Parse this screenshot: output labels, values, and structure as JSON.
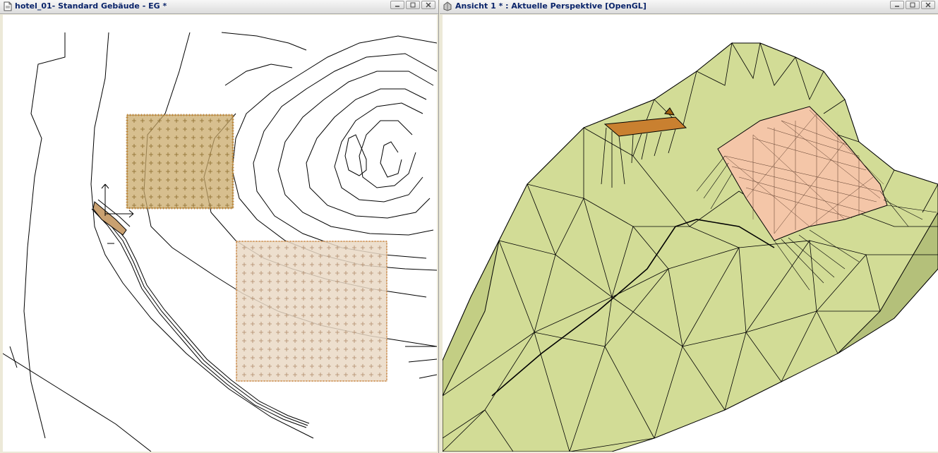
{
  "left_window": {
    "title": "hotel_01- Standard Gebäude - EG *",
    "icon": "document-icon",
    "buttons": [
      "minimize-icon",
      "maximize-icon",
      "close-icon"
    ]
  },
  "right_window": {
    "title": "Ansicht 1 *  : Aktuelle Perspektive [OpenGL]",
    "icon": "view-icon",
    "buttons": [
      "minimize-icon",
      "maximize-icon",
      "close-icon"
    ]
  },
  "colors": {
    "title_text": "#0a246a",
    "terrain": "#d2dc96",
    "terrain_dark": "#b4c07a",
    "roof_pink": "#f4c6a8",
    "plot_brown": "#c9a96a",
    "plot_light": "#ead9c6"
  }
}
